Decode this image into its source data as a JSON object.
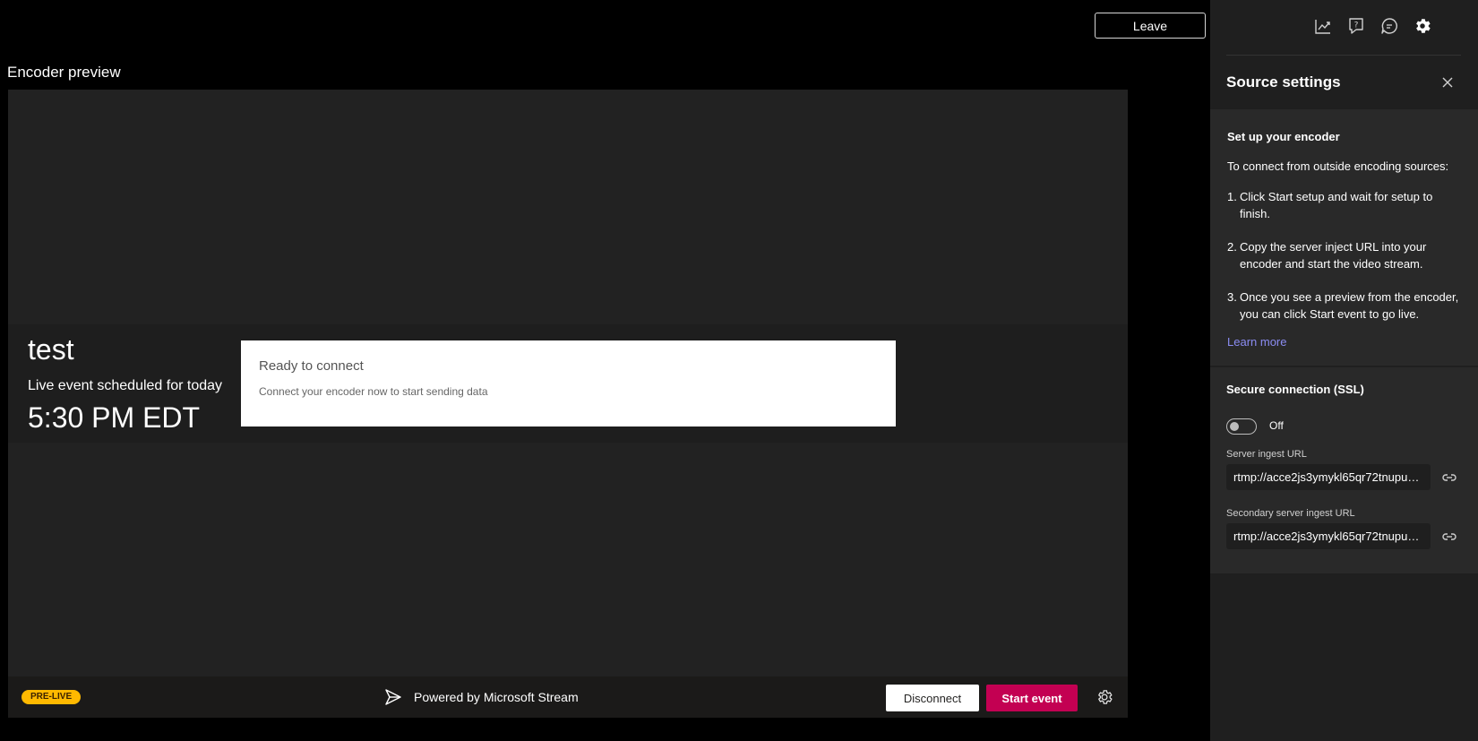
{
  "header": {
    "leave_label": "Leave"
  },
  "preview": {
    "title": "Encoder preview",
    "event_name": "test",
    "schedule_text": "Live event scheduled for today",
    "time_text": "5:30 PM EDT",
    "ready_title": "Ready to connect",
    "ready_subtitle": "Connect your encoder now to start sending data"
  },
  "bottom_bar": {
    "badge": "PRE-LIVE",
    "powered_by": "Powered by Microsoft Stream",
    "disconnect_label": "Disconnect",
    "start_label": "Start event"
  },
  "panel": {
    "icons": [
      "analytics-icon",
      "help-icon",
      "chat-icon",
      "settings-icon"
    ],
    "title": "Source settings",
    "setup": {
      "title": "Set up your encoder",
      "intro": "To connect from outside encoding sources:",
      "steps": [
        {
          "num": "1.",
          "text": "Click Start setup and wait for setup to finish."
        },
        {
          "num": "2.",
          "text": "Copy the server inject URL into your encoder and start the video stream."
        },
        {
          "num": "3.",
          "text": "Once you see a preview from the encoder, you can click Start event to go live."
        }
      ],
      "learn_more": "Learn more"
    },
    "secure": {
      "title": "Secure connection (SSL)",
      "toggle_state": "Off",
      "server_label": "Server ingest URL",
      "server_url": "rtmp://acce2js3ymykl65qr72tnupun...",
      "secondary_label": "Secondary server ingest URL",
      "secondary_url": "rtmp://acce2js3ymykl65qr72tnupun..."
    }
  },
  "colors": {
    "background": "#000000",
    "stage": "#222222",
    "panel": "#1f1f1f",
    "panel_section": "#292929",
    "accent_start": "#c30052",
    "badge": "#ffb900",
    "link": "#8b8cf2"
  }
}
